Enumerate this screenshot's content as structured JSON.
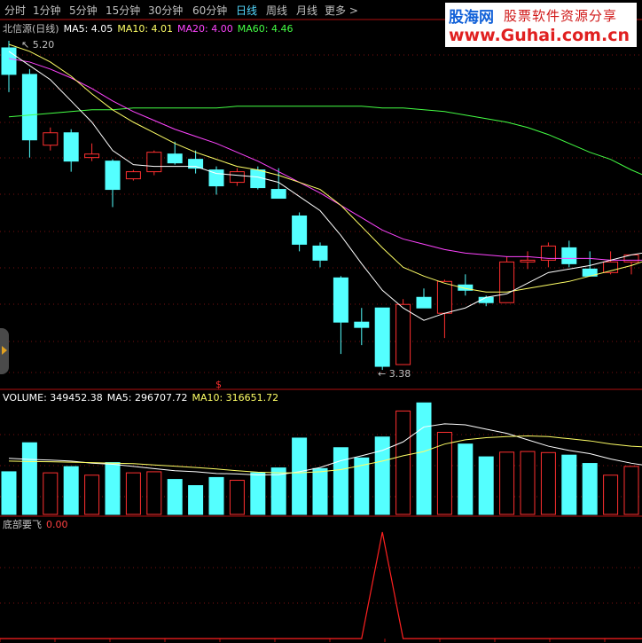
{
  "toolbar": {
    "tabs": [
      "分时",
      "1分钟",
      "5分钟",
      "15分钟",
      "30分钟",
      "60分钟",
      "日线",
      "周线",
      "月线",
      "更多 >"
    ],
    "active": "日线"
  },
  "logo": {
    "line1": "股海网",
    "line1b": "股票软件资源分享",
    "line2": "www.Guhai.com.cn"
  },
  "price_panel": {
    "title": "北信源(日线)",
    "ma": [
      {
        "label": "MA5: 4.05",
        "color": "#ffffff"
      },
      {
        "label": "MA10: 4.01",
        "color": "#ffff66"
      },
      {
        "label": "MA20: 4.00",
        "color": "#ff44ff"
      },
      {
        "label": "MA60: 4.46",
        "color": "#44ff44"
      }
    ],
    "high_label": "5.20",
    "low_label": "3.38",
    "marker": "$"
  },
  "volume_panel": {
    "labels": [
      {
        "label": "VOLUME: 349452.38",
        "color": "#ffffff"
      },
      {
        "label": "MA5: 296707.72",
        "color": "#ffffff"
      },
      {
        "label": "MA10: 316651.72",
        "color": "#ffff66"
      }
    ]
  },
  "indicator_panel": {
    "title": "底部要飞",
    "value": "0.00",
    "value_color": "#ff4040"
  },
  "colors": {
    "up": "#ff3030",
    "down": "#54ffff",
    "ma5": "#ffffff",
    "ma10": "#ffff66",
    "ma20": "#ff44ff",
    "ma60": "#44ff44",
    "grid": "#7a1010"
  },
  "chart_data": {
    "type": "candlestick",
    "ylim": [
      3.28,
      5.26
    ],
    "volume_ylim": [
      0,
      520000
    ],
    "indicator_ylim": [
      0,
      1
    ],
    "candles": [
      {
        "o": 5.2,
        "h": 5.24,
        "l": 4.95,
        "c": 5.05
      },
      {
        "o": 5.05,
        "h": 5.08,
        "l": 4.58,
        "c": 4.68
      },
      {
        "o": 4.65,
        "h": 4.75,
        "l": 4.62,
        "c": 4.72
      },
      {
        "o": 4.72,
        "h": 4.74,
        "l": 4.5,
        "c": 4.56
      },
      {
        "o": 4.58,
        "h": 4.66,
        "l": 4.56,
        "c": 4.6
      },
      {
        "o": 4.56,
        "h": 4.57,
        "l": 4.3,
        "c": 4.4
      },
      {
        "o": 4.46,
        "h": 4.51,
        "l": 4.45,
        "c": 4.5
      },
      {
        "o": 4.5,
        "h": 4.62,
        "l": 4.48,
        "c": 4.61
      },
      {
        "o": 4.6,
        "h": 4.67,
        "l": 4.54,
        "c": 4.55
      },
      {
        "o": 4.57,
        "h": 4.62,
        "l": 4.49,
        "c": 4.52
      },
      {
        "o": 4.51,
        "h": 4.53,
        "l": 4.37,
        "c": 4.42
      },
      {
        "o": 4.44,
        "h": 4.52,
        "l": 4.42,
        "c": 4.5
      },
      {
        "o": 4.51,
        "h": 4.53,
        "l": 4.4,
        "c": 4.41
      },
      {
        "o": 4.4,
        "h": 4.52,
        "l": 4.35,
        "c": 4.35
      },
      {
        "o": 4.25,
        "h": 4.27,
        "l": 4.05,
        "c": 4.09
      },
      {
        "o": 4.08,
        "h": 4.1,
        "l": 3.96,
        "c": 4.0
      },
      {
        "o": 3.9,
        "h": 3.91,
        "l": 3.47,
        "c": 3.65
      },
      {
        "o": 3.65,
        "h": 3.73,
        "l": 3.52,
        "c": 3.62
      },
      {
        "o": 3.73,
        "h": 3.73,
        "l": 3.38,
        "c": 3.4
      },
      {
        "o": 3.41,
        "h": 3.78,
        "l": 3.41,
        "c": 3.75
      },
      {
        "o": 3.79,
        "h": 3.84,
        "l": 3.73,
        "c": 3.73
      },
      {
        "o": 3.7,
        "h": 3.89,
        "l": 3.56,
        "c": 3.88
      },
      {
        "o": 3.86,
        "h": 3.92,
        "l": 3.8,
        "c": 3.83
      },
      {
        "o": 3.79,
        "h": 3.8,
        "l": 3.74,
        "c": 3.76
      },
      {
        "o": 3.76,
        "h": 4.02,
        "l": 3.76,
        "c": 3.99
      },
      {
        "o": 3.99,
        "h": 4.05,
        "l": 3.95,
        "c": 4.0
      },
      {
        "o": 4.0,
        "h": 4.1,
        "l": 3.96,
        "c": 4.08
      },
      {
        "o": 4.07,
        "h": 4.11,
        "l": 3.96,
        "c": 3.98
      },
      {
        "o": 3.95,
        "h": 4.05,
        "l": 3.92,
        "c": 3.91
      },
      {
        "o": 3.93,
        "h": 4.05,
        "l": 3.92,
        "c": 3.99
      },
      {
        "o": 3.99,
        "h": 4.01,
        "l": 3.92,
        "c": 4.03
      },
      {
        "o": 3.98,
        "h": 4.03,
        "l": 3.96,
        "c": 4.03
      }
    ],
    "ma5": [
      5.18,
      5.1,
      5.02,
      4.9,
      4.78,
      4.62,
      4.54,
      4.53,
      4.53,
      4.53,
      4.49,
      4.48,
      4.47,
      4.44,
      4.36,
      4.28,
      4.14,
      3.98,
      3.83,
      3.73,
      3.66,
      3.7,
      3.73,
      3.79,
      3.81,
      3.87,
      3.93,
      3.95,
      3.97,
      4.0,
      4.03,
      4.05
    ],
    "ma10": [
      5.22,
      5.18,
      5.12,
      5.04,
      4.94,
      4.85,
      4.78,
      4.72,
      4.66,
      4.61,
      4.57,
      4.53,
      4.51,
      4.48,
      4.44,
      4.4,
      4.31,
      4.19,
      4.07,
      3.96,
      3.91,
      3.87,
      3.84,
      3.82,
      3.82,
      3.84,
      3.86,
      3.88,
      3.91,
      3.94,
      3.97,
      4.01
    ],
    "ma20": [
      5.14,
      5.12,
      5.08,
      5.03,
      4.97,
      4.9,
      4.84,
      4.79,
      4.74,
      4.7,
      4.66,
      4.61,
      4.56,
      4.5,
      4.44,
      4.38,
      4.31,
      4.24,
      4.17,
      4.12,
      4.09,
      4.06,
      4.04,
      4.03,
      4.02,
      4.02,
      4.01,
      4.01,
      4.01,
      4.0,
      4.0,
      4.0
    ],
    "ma60": [
      4.81,
      4.82,
      4.83,
      4.84,
      4.85,
      4.85,
      4.86,
      4.86,
      4.86,
      4.86,
      4.86,
      4.87,
      4.87,
      4.87,
      4.87,
      4.87,
      4.87,
      4.87,
      4.86,
      4.86,
      4.85,
      4.84,
      4.82,
      4.8,
      4.78,
      4.75,
      4.71,
      4.66,
      4.61,
      4.57,
      4.51,
      4.46
    ],
    "volume": [
      200000,
      336000,
      195000,
      224000,
      184000,
      243000,
      195000,
      200000,
      164000,
      135000,
      173000,
      160000,
      195000,
      218000,
      358000,
      215000,
      313000,
      265000,
      363000,
      485000,
      523000,
      385000,
      330000,
      270000,
      292000,
      295000,
      290000,
      278000,
      239000,
      184000,
      225000,
      145000
    ],
    "vol_ma5": [
      263000,
      258000,
      255000,
      250000,
      240000,
      235000,
      225000,
      215000,
      205000,
      200000,
      192000,
      190000,
      185000,
      186000,
      200000,
      220000,
      252000,
      275000,
      300000,
      340000,
      410000,
      425000,
      420000,
      400000,
      380000,
      350000,
      320000,
      300000,
      285000,
      260000,
      240000,
      225000
    ],
    "vol_ma10": [
      250000,
      248000,
      247000,
      245000,
      243000,
      240000,
      238000,
      232000,
      226000,
      220000,
      213000,
      205000,
      198000,
      195000,
      195000,
      200000,
      210000,
      230000,
      250000,
      275000,
      295000,
      330000,
      350000,
      360000,
      365000,
      368000,
      365000,
      355000,
      345000,
      330000,
      320000,
      315000
    ],
    "indicator": [
      0,
      0,
      0,
      0,
      0,
      0,
      0,
      0,
      0,
      0,
      0,
      0,
      0,
      0,
      0,
      0,
      0,
      0,
      1,
      0,
      0,
      0,
      0,
      0,
      0,
      0,
      0,
      0,
      0,
      0,
      0,
      0
    ]
  }
}
